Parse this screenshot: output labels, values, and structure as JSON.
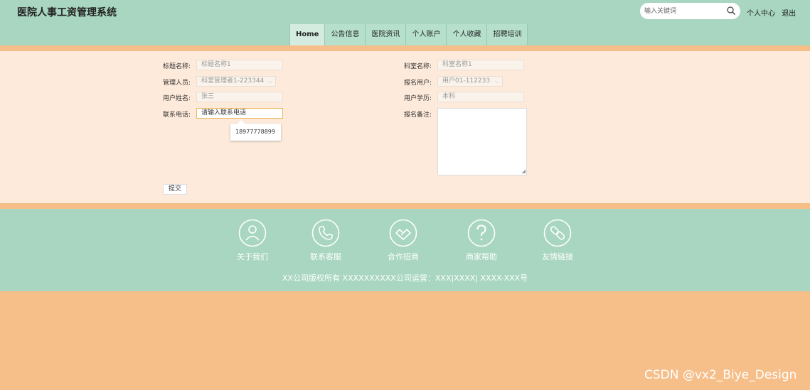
{
  "header": {
    "title": "医院人事工资管理系统",
    "search_placeholder": "输入关键词",
    "links": [
      "个人中心",
      "退出"
    ]
  },
  "nav": {
    "items": [
      "Home",
      "公告信息",
      "医院资讯",
      "个人账户",
      "个人收藏",
      "招聘培训"
    ],
    "active": "Home"
  },
  "form": {
    "left": [
      {
        "label": "标题名称:",
        "value": "标题名称1",
        "type": "text"
      },
      {
        "label": "管理人员:",
        "value": "科室管理者1-223344",
        "type": "select"
      },
      {
        "label": "用户姓名:",
        "value": "张三",
        "type": "text"
      },
      {
        "label": "联系电话:",
        "value": "请输入联系电话",
        "type": "text"
      }
    ],
    "right": [
      {
        "label": "科室名称:",
        "value": "科室名称1",
        "type": "text"
      },
      {
        "label": "报名用户:",
        "value": "用户01-112233",
        "type": "select"
      },
      {
        "label": "用户学历:",
        "value": "本科",
        "type": "text"
      },
      {
        "label": "报名备注:",
        "value": "",
        "type": "textarea"
      }
    ],
    "autocomplete_option": "18977778899",
    "submit_label": "提交"
  },
  "footer": {
    "items": [
      {
        "label": "关于我们",
        "icon": "user-icon"
      },
      {
        "label": "联系客服",
        "icon": "phone-icon"
      },
      {
        "label": "合作招商",
        "icon": "handshake-icon"
      },
      {
        "label": "商家帮助",
        "icon": "help-icon"
      },
      {
        "label": "友情链接",
        "icon": "link-icon"
      }
    ],
    "copyright": "XX公司版权所有 XXXXXXXXXX公司运营：XXX|XXXX| XXXX-XXX号"
  },
  "watermark": "CSDN @vx2_Biye_Design",
  "colors": {
    "header_bg": "#a8d6c0",
    "accent_orange": "#f6be88",
    "form_bg": "#fdeadb",
    "focus_border": "#e8b860"
  }
}
